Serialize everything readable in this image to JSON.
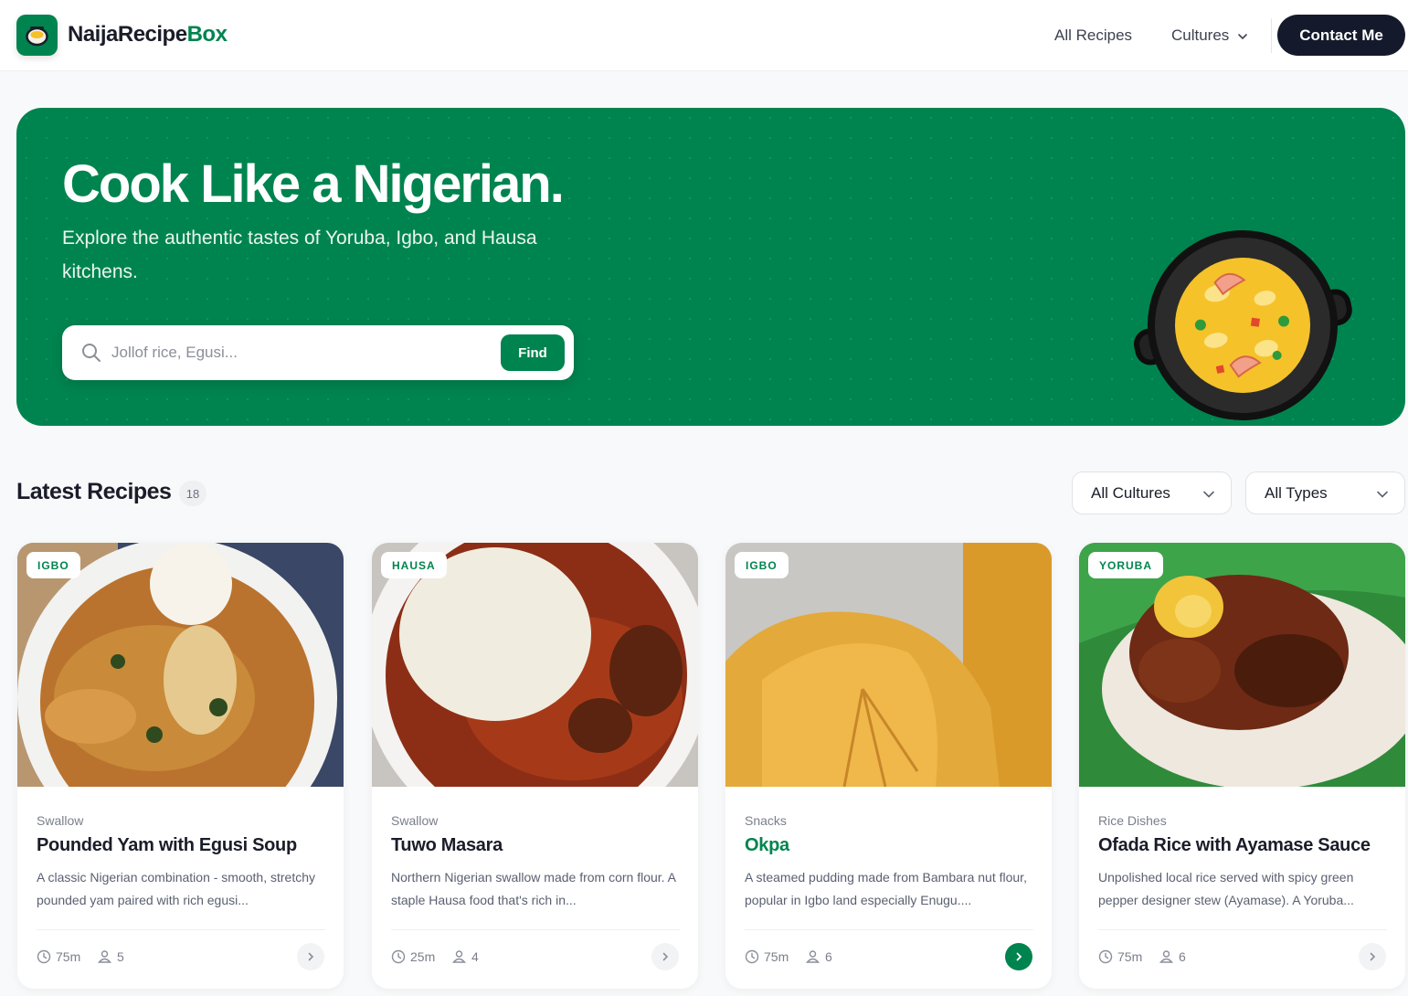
{
  "header": {
    "logo_main": "NaijaRecipe",
    "logo_accent": "Box",
    "nav": {
      "all_recipes": "All Recipes",
      "cultures": "Cultures"
    },
    "contact": "Contact Me"
  },
  "hero": {
    "title": "Cook Like a Nigerian.",
    "subtitle": "Explore the authentic tastes of Yoruba, Igbo, and Hausa kitchens.",
    "search_placeholder": "Jollof rice, Egusi...",
    "find_label": "Find"
  },
  "section": {
    "title": "Latest Recipes",
    "count": "18",
    "filter_culture": "All Cultures",
    "filter_type": "All Types"
  },
  "recipes": [
    {
      "tag": "IGBO",
      "category": "Swallow",
      "title": "Pounded Yam with Egusi Soup",
      "description": "A classic Nigerian combination - smooth, stretchy pounded yam paired with rich egusi...",
      "time": "75m",
      "servings": "5"
    },
    {
      "tag": "HAUSA",
      "category": "Swallow",
      "title": "Tuwo Masara",
      "description": "Northern Nigerian swallow made from corn flour. A staple Hausa food that's rich in...",
      "time": "25m",
      "servings": "4"
    },
    {
      "tag": "IGBO",
      "category": "Snacks",
      "title": "Okpa",
      "description": "A steamed pudding made from Bambara nut flour, popular in Igbo land especially Enugu....",
      "time": "75m",
      "servings": "6"
    },
    {
      "tag": "YORUBA",
      "category": "Rice Dishes",
      "title": "Ofada Rice with Ayamase Sauce",
      "description": "Unpolished local rice served with spicy green pepper designer stew (Ayamase). A Yoruba...",
      "time": "75m",
      "servings": "6"
    }
  ],
  "icons": {
    "logo": "pot-icon",
    "nav_dropdown": "chevron-down-icon",
    "search": "search-icon",
    "hero_art": "pot-illustration",
    "time": "clock-icon",
    "servings": "people-icon",
    "card_open": "chevron-right-icon"
  },
  "colors": {
    "brand": "#00844f",
    "dark": "#141a2b",
    "background": "#f8f9fa"
  }
}
